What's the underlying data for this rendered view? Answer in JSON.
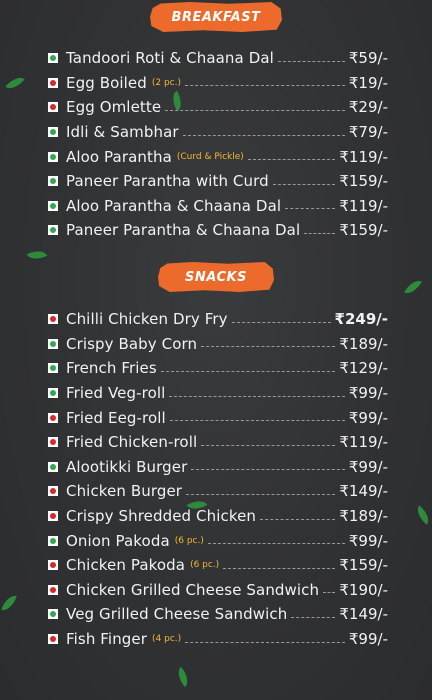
{
  "breakfast": {
    "title": "BREAKFAST",
    "items": [
      {
        "type": "veg",
        "name": "Tandoori Roti & Chaana Dal",
        "note": "",
        "price": "₹59/-"
      },
      {
        "type": "nonveg",
        "name": "Egg Boiled",
        "note": "(2 pc.)",
        "price": "₹19/-"
      },
      {
        "type": "nonveg",
        "name": "Egg Omlette",
        "note": "",
        "price": "₹29/-"
      },
      {
        "type": "veg",
        "name": "Idli & Sambhar",
        "note": "",
        "price": "₹79/-"
      },
      {
        "type": "veg",
        "name": "Aloo Parantha",
        "note": "(Curd & Pickle)",
        "price": "₹119/-"
      },
      {
        "type": "veg",
        "name": "Paneer Parantha with Curd",
        "note": "",
        "price": "₹159/-"
      },
      {
        "type": "veg",
        "name": "Aloo Parantha & Chaana Dal",
        "note": "",
        "price": "₹119/-"
      },
      {
        "type": "veg",
        "name": "Paneer Parantha & Chaana Dal",
        "note": "",
        "price": "₹159/-"
      }
    ]
  },
  "snacks": {
    "title": "SNACKS",
    "items": [
      {
        "type": "nonveg",
        "name": "Chilli Chicken Dry Fry",
        "note": "",
        "price": "₹249/-",
        "bold": true
      },
      {
        "type": "veg",
        "name": "Crispy Baby Corn",
        "note": "",
        "price": "₹189/-"
      },
      {
        "type": "veg",
        "name": "French Fries",
        "note": "",
        "price": "₹129/-"
      },
      {
        "type": "veg",
        "name": "Fried Veg-roll",
        "note": "",
        "price": "₹99/-"
      },
      {
        "type": "nonveg",
        "name": "Fried Eeg-roll",
        "note": "",
        "price": "₹99/-"
      },
      {
        "type": "nonveg",
        "name": "Fried Chicken-roll",
        "note": "",
        "price": "₹119/-"
      },
      {
        "type": "veg",
        "name": "Alootikki Burger",
        "note": "",
        "price": "₹99/-"
      },
      {
        "type": "nonveg",
        "name": "Chicken Burger",
        "note": "",
        "price": "₹149/-"
      },
      {
        "type": "nonveg",
        "name": "Crispy Shredded Chicken",
        "note": "",
        "price": "₹189/-"
      },
      {
        "type": "veg",
        "name": "Onion Pakoda",
        "note": "(6 pc.)",
        "price": "₹99/-"
      },
      {
        "type": "nonveg",
        "name": "Chicken Pakoda",
        "note": "(6 pc.)",
        "price": "₹159/-"
      },
      {
        "type": "nonveg",
        "name": "Chicken Grilled Cheese Sandwich",
        "note": "",
        "price": "₹190/-"
      },
      {
        "type": "veg",
        "name": "Veg Grilled Cheese Sandwich",
        "note": "",
        "price": "₹149/-"
      },
      {
        "type": "nonveg",
        "name": "Fish Finger",
        "note": "(4 pc.)",
        "price": "₹99/-"
      }
    ]
  },
  "colors": {
    "accent": "#ec6a2b",
    "veg": "#2fa84f",
    "nonveg": "#d8262b",
    "note": "#f5b731",
    "background": "#333436"
  }
}
